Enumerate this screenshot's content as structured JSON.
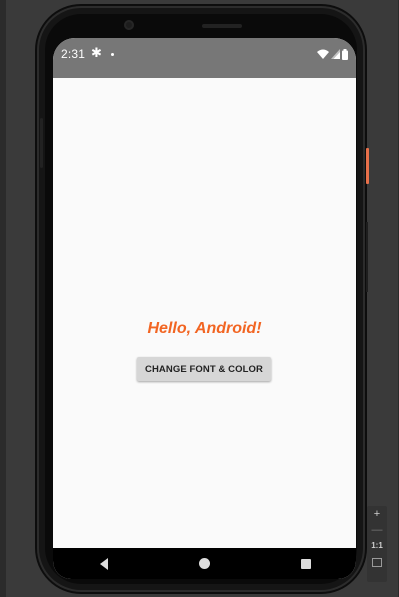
{
  "status_bar": {
    "time": "2:31",
    "gear_glyph": "✱",
    "icons": [
      "wifi-icon",
      "signal-icon",
      "battery-icon"
    ]
  },
  "app": {
    "greeting": "Hello, Android!",
    "greeting_color": "#f26522",
    "button_label": "CHANGE FONT & COLOR"
  },
  "nav": {
    "buttons": [
      "back-button",
      "home-button",
      "recents-button"
    ]
  },
  "emulator_zoom": {
    "plus": "+",
    "minus": "—",
    "ratio": "1:1"
  },
  "colors": {
    "status_bar_bg": "#777777",
    "screen_bg": "#fafafa",
    "button_bg": "#d6d6d6",
    "accent_edge": "#e8704a"
  }
}
